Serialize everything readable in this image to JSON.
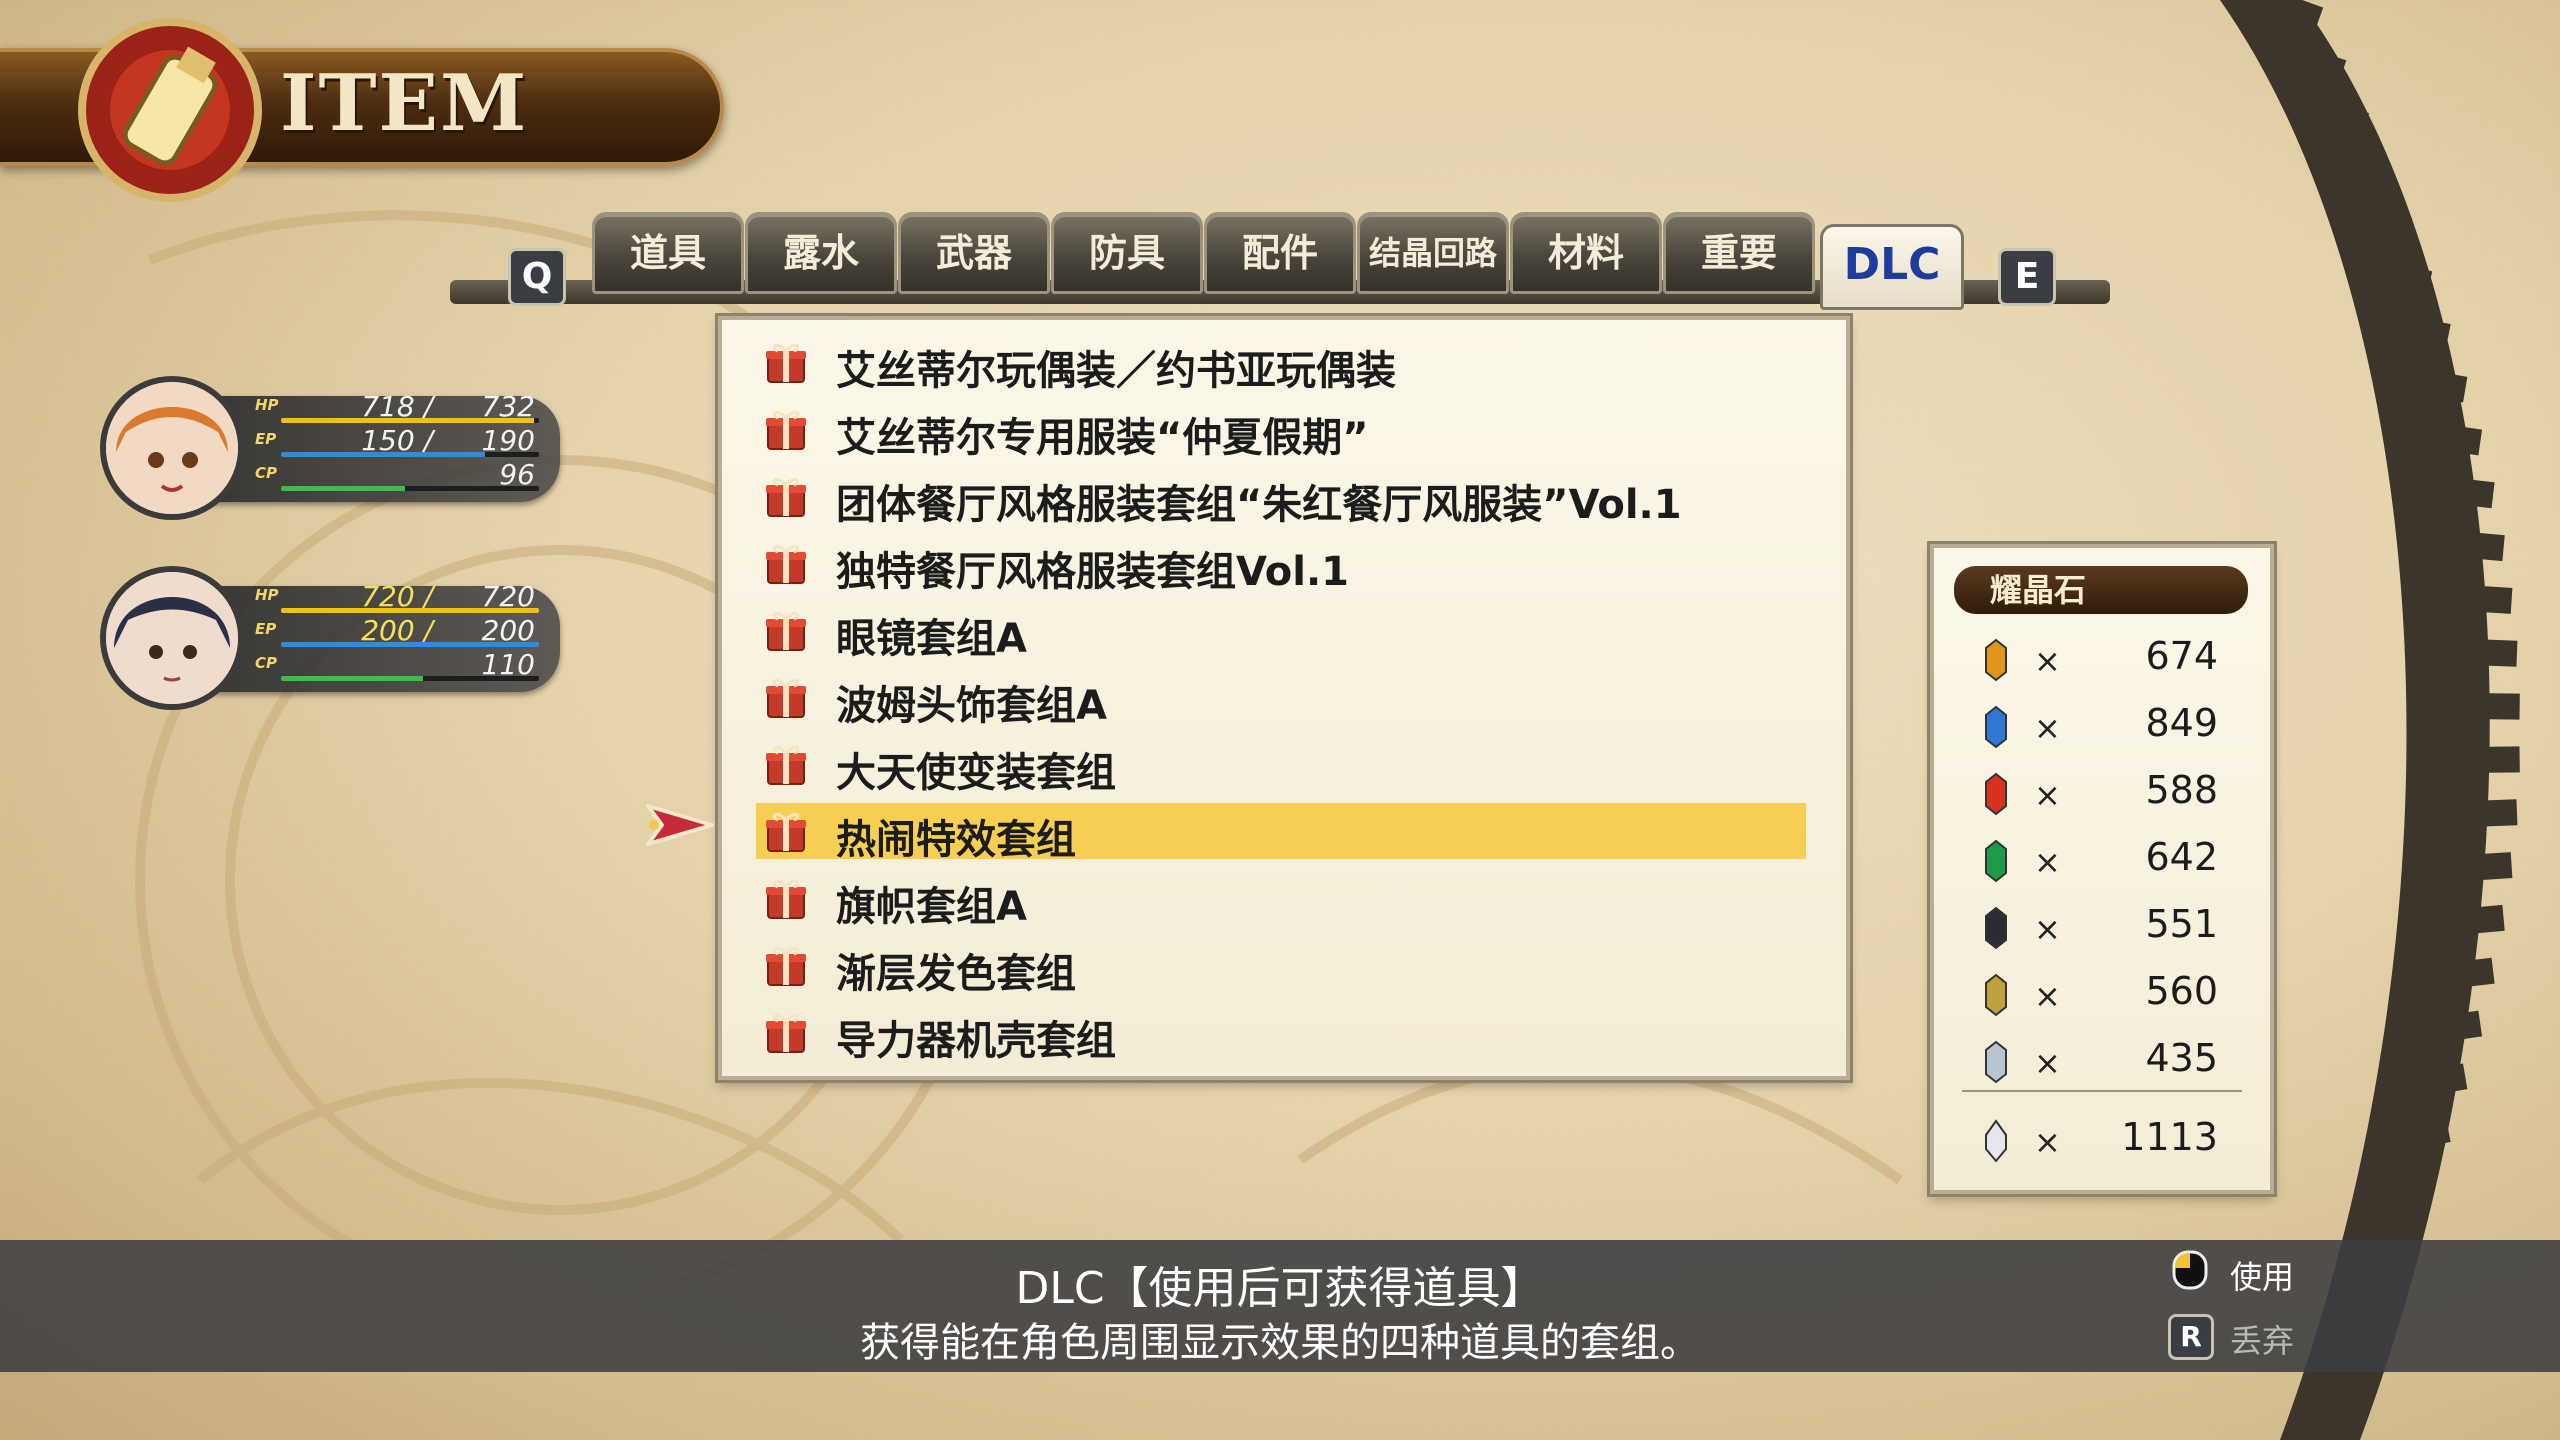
{
  "header": {
    "title": "ITEM"
  },
  "tabs": {
    "left_key": "Q",
    "right_key": "E",
    "items": [
      "道具",
      "露水",
      "武器",
      "防具",
      "配件",
      "结晶回路",
      "材料",
      "重要",
      "DLC"
    ],
    "active": "DLC"
  },
  "party": [
    {
      "hp_cur": "718 /",
      "hp_max": "732",
      "ep_cur": "150 /",
      "ep_max": "190",
      "cp": "96",
      "hp_frac": 0.98,
      "ep_frac": 0.79,
      "cp_frac": 0.48
    },
    {
      "hp_cur": "720 /",
      "hp_max": "720",
      "ep_cur": "200 /",
      "ep_max": "200",
      "cp": "110",
      "hp_frac": 1.0,
      "ep_frac": 1.0,
      "cp_frac": 0.55
    }
  ],
  "stat_labels": {
    "hp": "HP",
    "ep": "EP",
    "cp": "CP"
  },
  "items": [
    "艾丝蒂尔玩偶装／约书亚玩偶装",
    "艾丝蒂尔专用服装“仲夏假期”",
    "团体餐厅风格服装套组“朱红餐厅风服装”Vol.1",
    "独特餐厅风格服装套组Vol.1",
    "眼镜套组A",
    "波姆头饰套组A",
    "大天使变装套组",
    "热闹特效套组",
    "旗帜套组A",
    "渐层发色套组",
    "导力器机壳套组"
  ],
  "selected_index": 7,
  "sepith": {
    "title": "耀晶石",
    "times": "×",
    "rows": [
      {
        "color": "#e0951c",
        "value": "674"
      },
      {
        "color": "#2f78d6",
        "value": "849"
      },
      {
        "color": "#d8321e",
        "value": "588"
      },
      {
        "color": "#1f9a4a",
        "value": "642"
      },
      {
        "color": "#2c2c34",
        "value": "551"
      },
      {
        "color": "#bfa040",
        "value": "560"
      },
      {
        "color": "#b9c4d2",
        "value": "435"
      }
    ],
    "total": {
      "color": "#e6e6ee",
      "value": "1113"
    }
  },
  "description": {
    "line1": "DLC【使用后可获得道具】",
    "line2": "获得能在角色周围显示效果的四种道具的套组。"
  },
  "hints": {
    "use": "使用",
    "discard": "丢弃",
    "discard_key": "R"
  },
  "colors": {
    "hp": "#f0c020",
    "ep": "#2e8cdc",
    "cp": "#3bbf4a",
    "highlight": "#f6cf52"
  }
}
